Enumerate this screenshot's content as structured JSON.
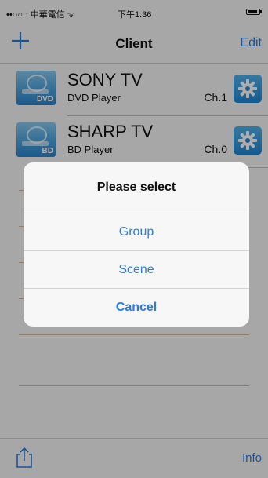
{
  "status_bar": {
    "carrier": "••○○○ 中華電信 ᯤ",
    "time": "下午1:36"
  },
  "nav": {
    "title": "Client",
    "edit_label": "Edit"
  },
  "devices": [
    {
      "name": "SONY TV",
      "type": "DVD Player",
      "channel": "Ch.1",
      "icon_tag": "DVD"
    },
    {
      "name": "SHARP TV",
      "type": "BD Player",
      "channel": "Ch.0",
      "icon_tag": "BD"
    }
  ],
  "action_sheet": {
    "title": "Please select",
    "options": [
      "Group",
      "Scene"
    ],
    "cancel_label": "Cancel"
  },
  "toolbar": {
    "share_icon": "share-icon",
    "info_label": "Info"
  },
  "colors": {
    "accent": "#2a7ce0",
    "separator": "#d8b99b"
  }
}
